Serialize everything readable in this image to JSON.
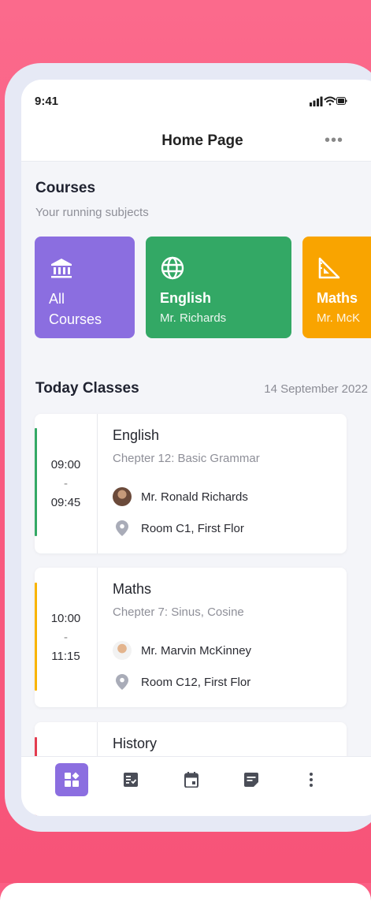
{
  "status_bar": {
    "time": "9:41"
  },
  "header": {
    "title": "Home Page",
    "more_label": "•••"
  },
  "courses": {
    "title": "Courses",
    "subtitle": "Your running subjects",
    "cards": [
      {
        "line1": "All",
        "line2": "Courses",
        "icon": "bank-icon",
        "color": "#8b6ee0"
      },
      {
        "name": "English",
        "teacher": "Mr. Richards",
        "icon": "globe-icon",
        "color": "#33a865"
      },
      {
        "name": "Maths",
        "teacher": "Mr. McK",
        "icon": "set-square-icon",
        "color": "#f9a400"
      }
    ]
  },
  "today": {
    "title": "Today Classes",
    "date": "14 September 2022",
    "classes": [
      {
        "start": "09:00",
        "sep": "-",
        "end": "09:45",
        "subject": "English",
        "chapter": "Chepter 12: Basic Grammar",
        "teacher": "Mr. Ronald Richards",
        "room": "Room C1, First Flor",
        "color": "#33a865"
      },
      {
        "start": "10:00",
        "sep": "-",
        "end": "11:15",
        "subject": "Maths",
        "chapter": "Chepter 7: Sinus, Cosine",
        "teacher": "Mr. Marvin McKinney",
        "room": "Room C12, First Flor",
        "color": "#f9b400"
      },
      {
        "subject": "History",
        "color": "#e33b4f"
      }
    ]
  },
  "bottom_nav": {
    "items": [
      "dashboard-icon",
      "tasks-icon",
      "calendar-icon",
      "notes-icon",
      "more-vertical-icon"
    ],
    "active_color": "#8b6ee0"
  }
}
